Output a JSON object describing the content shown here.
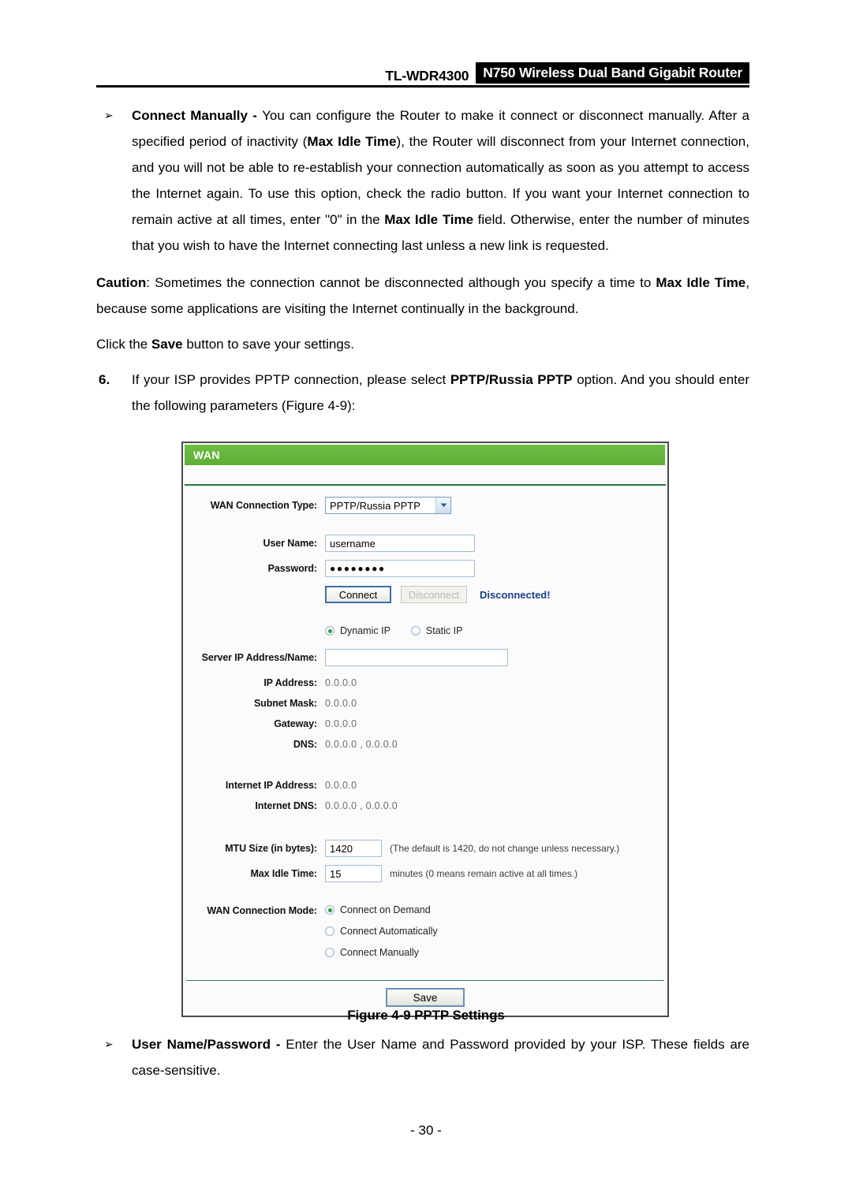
{
  "header": {
    "model": "TL-WDR4300",
    "product": "N750 Wireless Dual Band Gigabit Router"
  },
  "body": {
    "bullet_marker": "➢",
    "connect_manually": {
      "term": "Connect Manually - ",
      "text_1": "You can configure the Router to make it connect or disconnect manually. After a specified period of inactivity (",
      "bold_1": "Max Idle Time",
      "text_2": "), the Router will disconnect from your Internet connection, and you will not be able to re-establish your connection automatically as soon as you attempt to access the Internet again. To use this option, check the radio button. If you want your Internet connection to remain active at all times, enter \"0\" in the ",
      "bold_2": "Max Idle Time",
      "text_3": " field. Otherwise, enter the number of minutes that you wish to have the Internet connecting last unless a new link is requested."
    },
    "caution": {
      "label": "Caution",
      "text_1": ": Sometimes the connection cannot be disconnected although you specify a time to ",
      "bold_1": "Max Idle Time",
      "text_2": ", because some applications are visiting the Internet continually in the background."
    },
    "save_note": {
      "text_1": "Click the ",
      "bold_1": "Save",
      "text_2": " button to save your settings."
    },
    "step6": {
      "number": "6.",
      "text_1": "If your ISP provides PPTP connection, please select ",
      "bold_1": "PPTP/Russia PPTP",
      "text_2": " option. And you should enter the following parameters (Figure 4-9):"
    },
    "user_pass_bullet": {
      "term": "User Name/Password - ",
      "text_1": "Enter the User Name and Password provided by your ISP. These fields are case-sensitive."
    }
  },
  "figure": {
    "caption": "Figure 4-9 PPTP Settings",
    "panel_title": "WAN",
    "fields": {
      "wan_connection_type": {
        "label": "WAN Connection Type:",
        "value": "PPTP/Russia PPTP",
        "options": [
          "PPTP/Russia PPTP"
        ]
      },
      "user_name": {
        "label": "User Name:",
        "value": "username"
      },
      "password": {
        "label": "Password:",
        "value": "●●●●●●●●"
      },
      "connect_button": "Connect",
      "disconnect_button": "Disconnect",
      "connection_status": "Disconnected!",
      "ip_mode": {
        "dynamic_label": "Dynamic IP",
        "static_label": "Static IP",
        "selected": "Dynamic IP"
      },
      "server_ip": {
        "label": "Server IP Address/Name:",
        "value": ""
      },
      "ip_address": {
        "label": "IP Address:",
        "value": "0.0.0.0"
      },
      "subnet_mask": {
        "label": "Subnet Mask:",
        "value": "0.0.0.0"
      },
      "gateway": {
        "label": "Gateway:",
        "value": "0.0.0.0"
      },
      "dns": {
        "label": "DNS:",
        "value": "0.0.0.0 , 0.0.0.0"
      },
      "internet_ip_address": {
        "label": "Internet IP Address:",
        "value": "0.0.0.0"
      },
      "internet_dns": {
        "label": "Internet DNS:",
        "value": "0.0.0.0 , 0.0.0.0"
      },
      "mtu_size": {
        "label": "MTU Size (in bytes):",
        "value": "1420",
        "hint": "(The default is 1420, do not change unless necessary.)"
      },
      "max_idle_time": {
        "label": "Max Idle Time:",
        "value": "15",
        "hint": "minutes (0 means remain active at all times.)"
      },
      "wan_connection_mode": {
        "label": "WAN Connection Mode:",
        "options": [
          "Connect on Demand",
          "Connect Automatically",
          "Connect Manually"
        ],
        "selected": "Connect on Demand"
      },
      "save_button": "Save"
    }
  },
  "footer": {
    "page": "- 30 -"
  },
  "colors": {
    "panel_green": "#64b43c",
    "divider_green": "#1f7a43",
    "status_blue": "#1b3f8b",
    "radio_dot_green": "#2e9b3c"
  }
}
